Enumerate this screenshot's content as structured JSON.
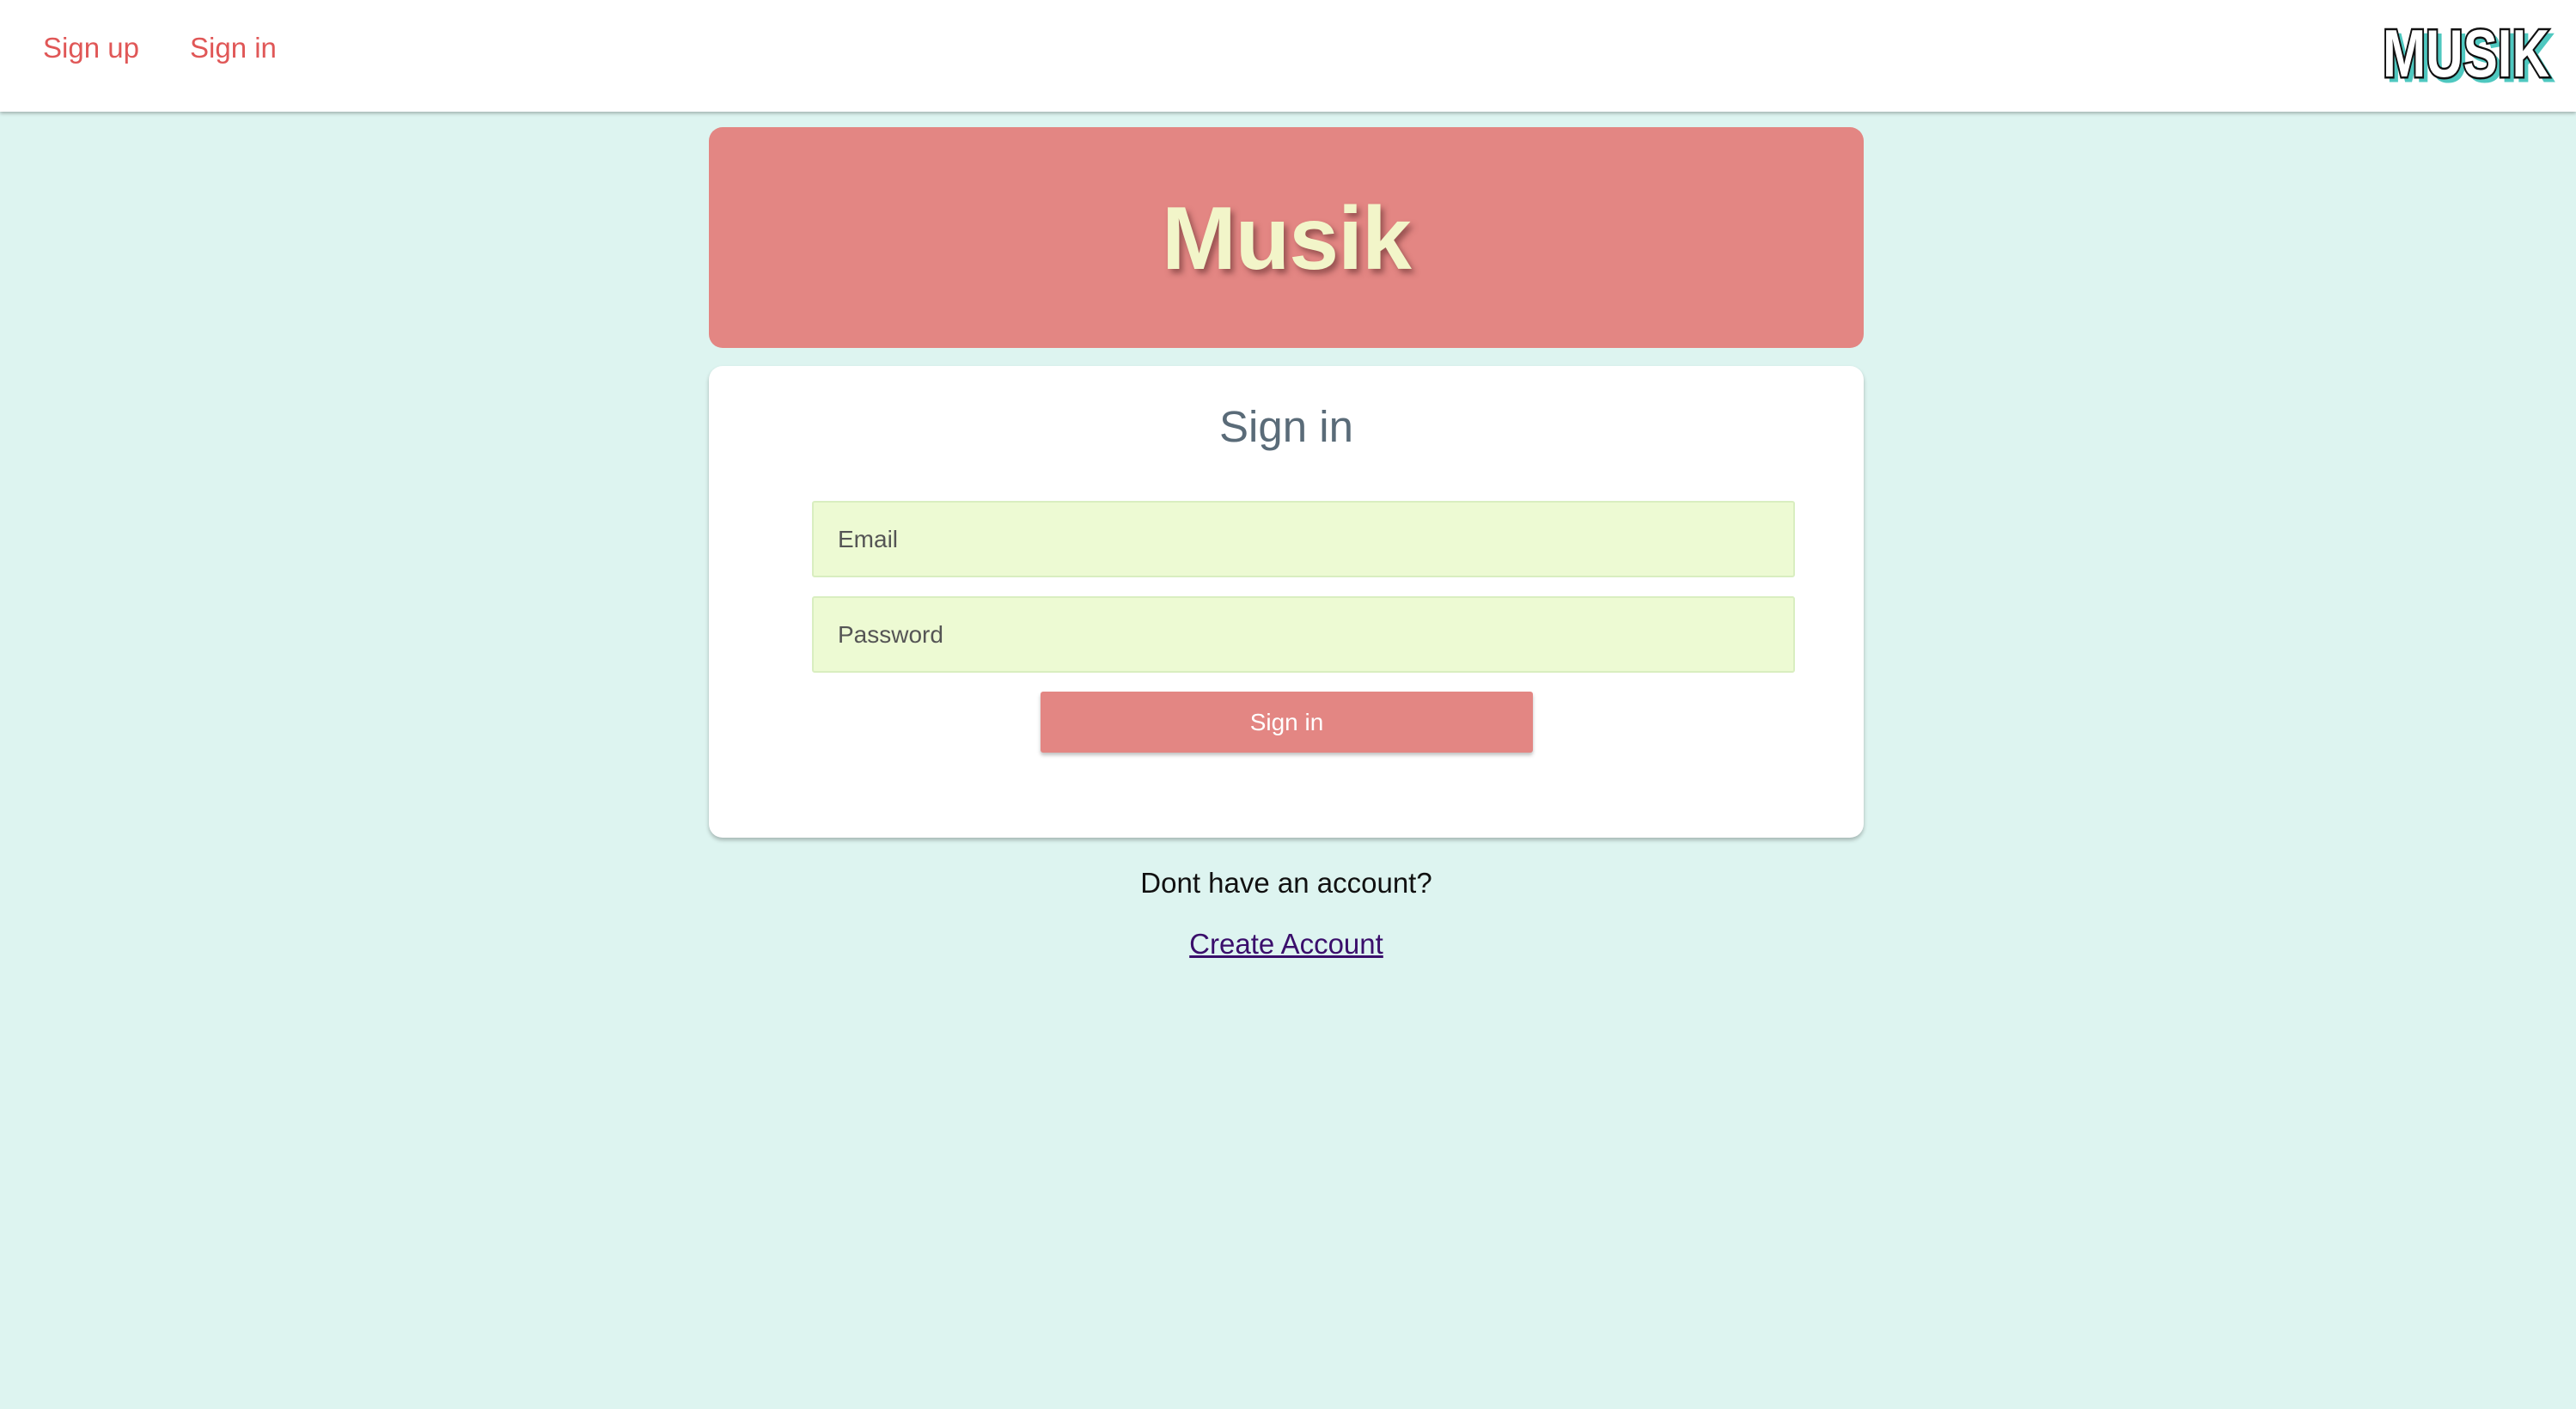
{
  "nav": {
    "signup_label": "Sign up",
    "signin_label": "Sign in"
  },
  "logo": {
    "text": "MUSIK"
  },
  "hero": {
    "title": "Musik"
  },
  "signin_form": {
    "title": "Sign in",
    "email_placeholder": "Email",
    "password_placeholder": "Password",
    "submit_label": "Sign in"
  },
  "footer": {
    "prompt": "Dont have an account?",
    "create_account_label": "Create Account"
  },
  "colors": {
    "background": "#ddf4f0",
    "accent": "#e38683",
    "link": "#e05757",
    "input_bg": "#edfad3",
    "hero_text": "#f2f5c9",
    "logo_shadow": "#4fc8c0"
  }
}
